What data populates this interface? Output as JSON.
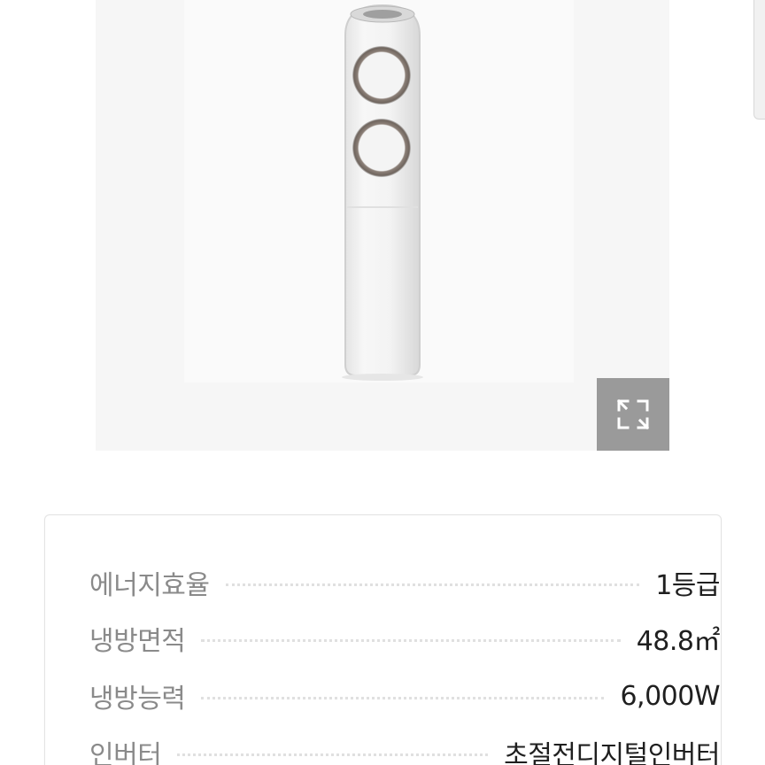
{
  "product_image": {
    "alt": "",
    "expand_icon": "expand-icon"
  },
  "specs": [
    {
      "label": "에너지효율",
      "value": "1등급"
    },
    {
      "label": "냉방면적",
      "value": "48.8㎡"
    },
    {
      "label": "냉방능력",
      "value": "6,000W"
    },
    {
      "label": "인버터",
      "value": "초절전디지털인버터"
    }
  ],
  "colors": {
    "label": "#8a8a8a",
    "value": "#1f1f1f",
    "expand_button_bg": "#9a9a9a"
  }
}
